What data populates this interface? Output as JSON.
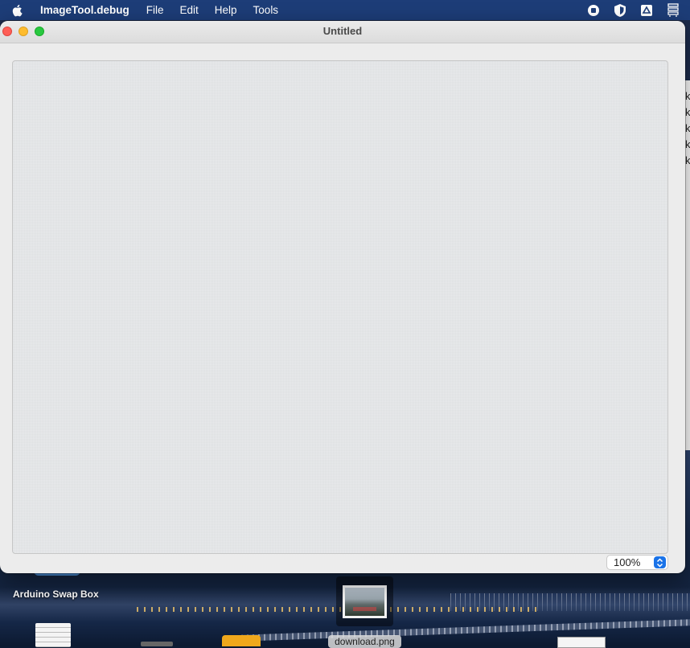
{
  "menubar": {
    "app_name": "ImageTool.debug",
    "items": [
      "File",
      "Edit",
      "Help",
      "Tools"
    ],
    "icons": [
      "stop-circle-icon",
      "shield-icon",
      "drive-icon",
      "wifi-qr-icon"
    ]
  },
  "window": {
    "title": "Untitled",
    "zoom": {
      "value": "100%"
    }
  },
  "desktop": {
    "folder_label": "Arduino Swap Box",
    "file_label": "download.png"
  },
  "colors": {
    "menubar_bg": "#1d3d78",
    "close": "#fe5f57",
    "minimize": "#febc2e",
    "maximize": "#28c840",
    "accent": "#1a73e8"
  }
}
